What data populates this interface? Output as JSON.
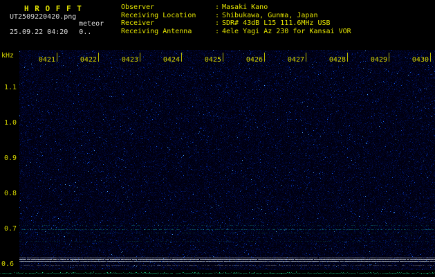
{
  "header": {
    "title": "H R O F F T",
    "filename": "UT2509220420.png",
    "mode_label": "meteor",
    "timestamp": "25.09.22 04:20",
    "counter": "0..",
    "colon_separator": ":",
    "info_rows": [
      {
        "label": "Observer",
        "value": "Masaki Kano"
      },
      {
        "label": "Receiving Location",
        "value": "Shibukawa, Gunma, Japan"
      },
      {
        "label": "Receiver",
        "value": "SDR# 43dB L15 111.6MHz USB"
      },
      {
        "label": "Receiving Antenna",
        "value": "4ele Yagi Az 230 for Kansai VOR"
      }
    ]
  },
  "colors": {
    "header_text_yellow": "#e6e600",
    "header_text_white": "#dcdcdc",
    "axis_label_yellow": "#d8d800",
    "background_black": "#000000",
    "spectrogram_base_blue": "#000011"
  },
  "chart_data": {
    "type": "heatmap",
    "title": "HROFFT 10-minute radio meteor spectrogram 04:20-04:30 UT",
    "x_axis": {
      "tick_labels": [
        "0421",
        "0422",
        "0423",
        "0424",
        "0425",
        "0426",
        "0427",
        "0428",
        "0429",
        "0430"
      ],
      "start": "04:20",
      "end": "04:30",
      "minutes_per_division": 1
    },
    "y_axis": {
      "unit_label": "kHz",
      "tick_labels": [
        "1.1",
        "1.0",
        "0.9",
        "0.8",
        "0.7",
        "0.6"
      ],
      "tick_values_khz": [
        1.1,
        1.0,
        0.9,
        0.8,
        0.7,
        0.6
      ],
      "range_khz": [
        0.598,
        1.208
      ]
    },
    "background": {
      "base_rgb": [
        0,
        0,
        17
      ],
      "noise_levels": [
        {
          "p": 0.35,
          "rgb": [
            0,
            4,
            40
          ]
        },
        {
          "p": 0.1,
          "rgb": [
            0,
            10,
            64
          ]
        },
        {
          "p": 0.03,
          "rgb": [
            0,
            26,
            110
          ]
        },
        {
          "p": 0.006,
          "rgb": [
            16,
            70,
            185
          ]
        },
        {
          "p": 0.0012,
          "rgb": [
            60,
            140,
            230
          ]
        }
      ]
    },
    "carrier_lines": [
      {
        "freq_khz": 0.712,
        "color": "#0e6f6f",
        "kind": "dashed"
      },
      {
        "freq_khz": 0.7,
        "color": "#128989",
        "kind": "faint"
      },
      {
        "freq_khz": 0.69,
        "color": "#0c5f5f",
        "kind": "dashed"
      },
      {
        "freq_khz": 0.667,
        "color": "#0a4d4d",
        "kind": "dashed"
      },
      {
        "freq_khz": 0.62,
        "color": "#9aa0a8",
        "kind": "solid"
      },
      {
        "freq_khz": 0.616,
        "color": "#cdd3da",
        "kind": "solid"
      },
      {
        "freq_khz": 0.61,
        "color": "#8a93a0",
        "kind": "solid"
      },
      {
        "freq_khz": 0.598,
        "color": "#6d6d74",
        "kind": "faint"
      }
    ],
    "bottom_strip": {
      "description": "signal-level trace",
      "base_color": "#000000",
      "trace_colors": [
        "#087048",
        "#0a8456",
        "#0c9a62",
        "#12b374"
      ],
      "highlight_color": "#2bd68f"
    }
  }
}
